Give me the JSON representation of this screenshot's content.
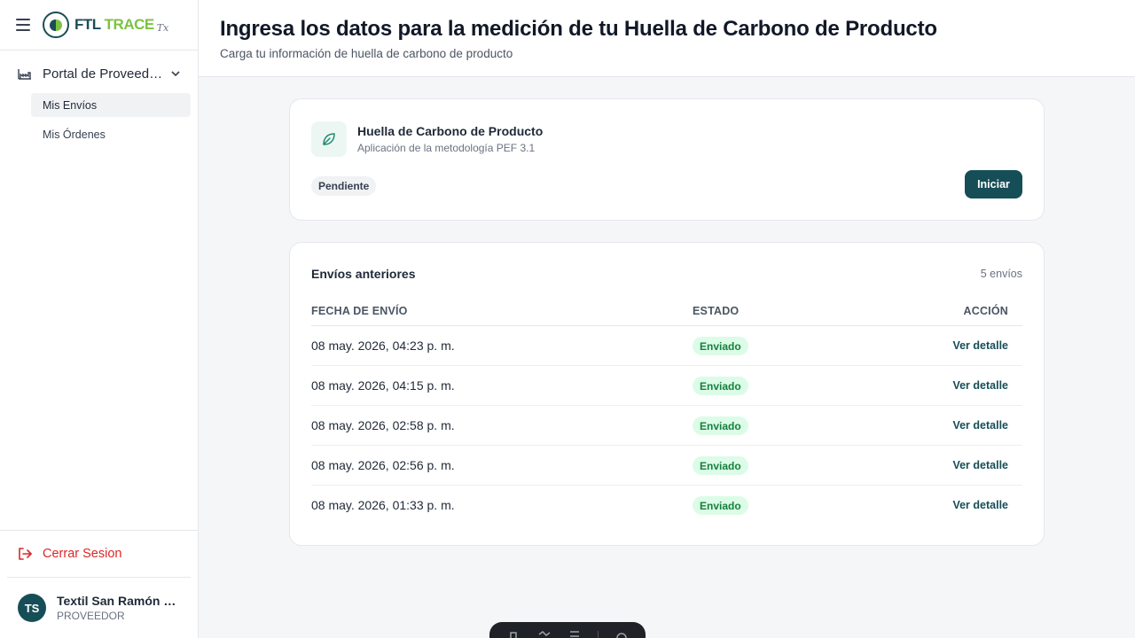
{
  "sidebar": {
    "logo": {
      "ftl": "FTL",
      "trace": "TRACE",
      "tx": "Tx"
    },
    "portal_label": "Portal de Proveedor...",
    "items": [
      {
        "label": "Mis Envíos",
        "active": true
      },
      {
        "label": "Mis Órdenes",
        "active": false
      }
    ],
    "logout_label": "Cerrar Sesion",
    "user": {
      "initials": "TS",
      "name": "Textil San Ramón S....",
      "role": "PROVEEDOR"
    }
  },
  "header": {
    "title": "Ingresa los datos para la medición de tu Huella de Carbono de Producto",
    "subtitle": "Carga tu información de huella de carbono de producto"
  },
  "pcf_card": {
    "title": "Huella de Carbono de Producto",
    "subtitle": "Aplicación de la metodología PEF 3.1",
    "status": "Pendiente",
    "start_label": "Iniciar"
  },
  "history": {
    "title": "Envíos anteriores",
    "count": "5 envíos",
    "columns": {
      "date": "FECHA DE ENVÍO",
      "status": "ESTADO",
      "action": "ACCIÓN"
    },
    "rows": [
      {
        "date": "08 may. 2026, 04:23 p. m.",
        "status": "Enviado",
        "action": "Ver detalle"
      },
      {
        "date": "08 may. 2026, 04:15 p. m.",
        "status": "Enviado",
        "action": "Ver detalle"
      },
      {
        "date": "08 may. 2026, 02:58 p. m.",
        "status": "Enviado",
        "action": "Ver detalle"
      },
      {
        "date": "08 may. 2026, 02:56 p. m.",
        "status": "Enviado",
        "action": "Ver detalle"
      },
      {
        "date": "08 may. 2026, 01:33 p. m.",
        "status": "Enviado",
        "action": "Ver detalle"
      }
    ]
  },
  "colors": {
    "brand_dark": "#164e57",
    "brand_green": "#7cc242",
    "danger": "#dc2626",
    "success_bg": "#dcfce7",
    "success_text": "#15803d"
  },
  "icons": {
    "menu": "hamburger-icon",
    "portal": "factory-icon",
    "chevron": "chevron-down-icon",
    "leaf": "leaf-icon",
    "logout": "logout-icon"
  }
}
